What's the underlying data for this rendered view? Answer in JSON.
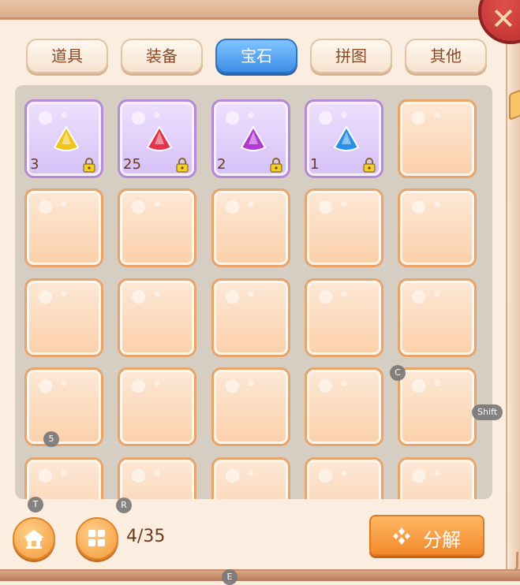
{
  "tabs": [
    {
      "label": "道具",
      "active": false
    },
    {
      "label": "装备",
      "active": false
    },
    {
      "label": "宝石",
      "active": true
    },
    {
      "label": "拼图",
      "active": false
    },
    {
      "label": "其他",
      "active": false
    }
  ],
  "inventory": {
    "items": [
      {
        "gem": "yellow-gem",
        "color": "#f2c318",
        "count": "3",
        "locked": true
      },
      {
        "gem": "red-gem",
        "color": "#e2334a",
        "count": "25",
        "locked": true
      },
      {
        "gem": "purple-gem",
        "color": "#b23ad4",
        "count": "2",
        "locked": true
      },
      {
        "gem": "blue-gem",
        "color": "#2a8fe6",
        "count": "1",
        "locked": true
      }
    ],
    "capacity_text": "4/35"
  },
  "buttons": {
    "decompose_label": "分解"
  },
  "hints": {
    "t": "T",
    "r": "R",
    "c": "C",
    "five": "5",
    "shift": "Shift",
    "e": "E"
  },
  "icons": {
    "close": "close-icon",
    "home": "home-icon",
    "grid": "grid-icon",
    "decompose": "decompose-icon",
    "lock": "lock-icon"
  }
}
